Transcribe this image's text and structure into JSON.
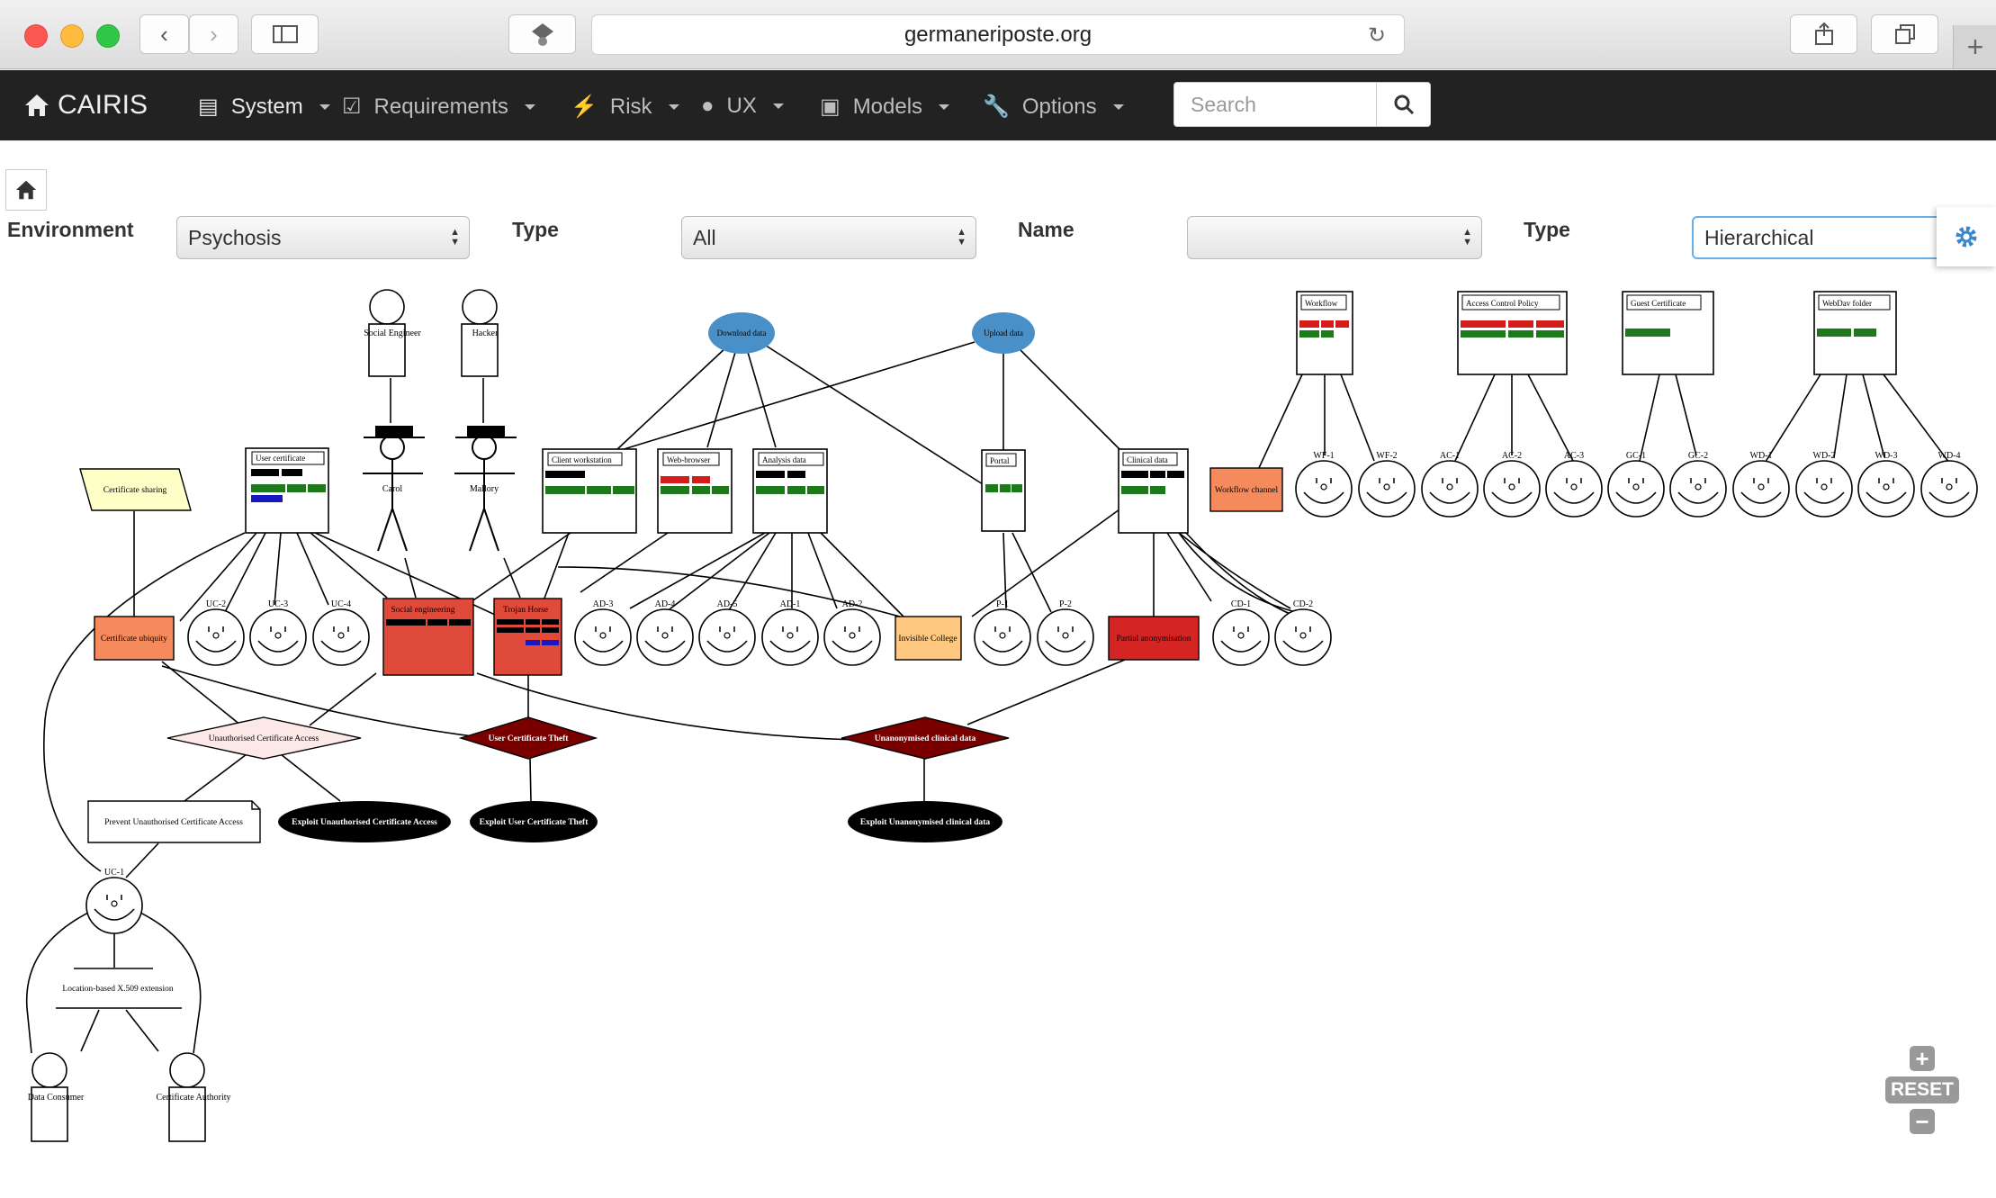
{
  "browser": {
    "url": "germaneriposte.org"
  },
  "nav": {
    "brand": "CAIRIS",
    "items": [
      "System",
      "Requirements",
      "Risk",
      "UX",
      "Models",
      "Options"
    ],
    "search_placeholder": "Search"
  },
  "filters": {
    "environment_label": "Environment",
    "environment_value": "Psychosis",
    "type_label": "Type",
    "type_value": "All",
    "name_label": "Name",
    "name_value": "",
    "layout_label": "Type",
    "layout_value": "Hierarchical"
  },
  "graph": {
    "persons": [
      "Social Engineer",
      "Hacker",
      "Data Consumer",
      "Certificate Authority"
    ],
    "attackers": [
      "Carol",
      "Mallory"
    ],
    "processes": [
      "Download data",
      "Upload data"
    ],
    "assets": [
      "User certificate",
      "Client workstation",
      "Web-browser",
      "Analysis data",
      "Portal",
      "Clinical data",
      "Workflow",
      "Access Control Policy",
      "Guest Certificate",
      "WebDav folder"
    ],
    "vulnerabilities": [
      "Certificate ubiquity",
      "Invisible College",
      "Workflow channel"
    ],
    "threats": [
      "Social engineering",
      "Trojan Horse",
      "Partial anonymisation"
    ],
    "goal": "Certificate sharing",
    "risks": [
      "Unauthorised Certificate Access",
      "User Certificate Theft",
      "Unanonymised clinical data"
    ],
    "misuse_cases": [
      "Exploit Unauthorised Certificate Access",
      "Exploit User Certificate Theft",
      "Exploit Unanonymised clinical data"
    ],
    "note": "Prevent Unauthorised Certificate Access",
    "responsibility": "Location-based X.509 extension",
    "usecases": [
      "UC-1",
      "UC-2",
      "UC-3",
      "UC-4",
      "AD-3",
      "AD-4",
      "AD-5",
      "AD-1",
      "AD-2",
      "P-1",
      "P-2",
      "CD-1",
      "CD-2",
      "WF-1",
      "WF-2",
      "AC-1",
      "AC-2",
      "AC-3",
      "GC-1",
      "GC-2",
      "WD-1",
      "WD-2",
      "WD-3",
      "WD-4"
    ]
  },
  "zoom": {
    "reset": "RESET"
  },
  "colors": {
    "process": "#4a90c8",
    "threat": "#e04a3a",
    "risk": "#7a0000",
    "vuln": "#f58a5c",
    "goal": "#ffffc8"
  }
}
